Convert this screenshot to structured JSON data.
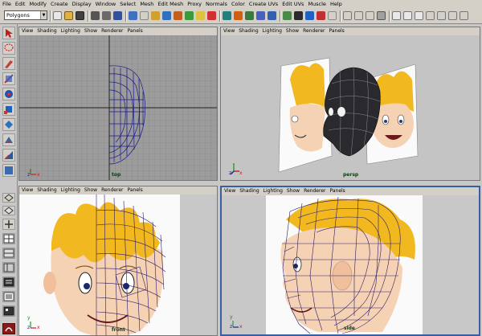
{
  "menubar": [
    "File",
    "Edit",
    "Modify",
    "Create",
    "Display",
    "Window",
    "Select",
    "Mesh",
    "Edit Mesh",
    "Proxy",
    "Normals",
    "Color",
    "Create UVs",
    "Edit UVs",
    "Muscle",
    "Help"
  ],
  "shelf": {
    "mode": "Polygons"
  },
  "viewport_menu": [
    "View",
    "Shading",
    "Lighting",
    "Show",
    "Renderer",
    "Panels"
  ],
  "viewports": {
    "top": {
      "camera": "top"
    },
    "persp": {
      "camera": "persp"
    },
    "front": {
      "camera": "front"
    },
    "side": {
      "camera": "side"
    }
  },
  "axes": {
    "x": "x",
    "y": "y",
    "z": "z"
  },
  "colors": {
    "grid_bg": "#9a9a9a",
    "grid_line": "#8a8a8a",
    "wire": "#1a1a8a",
    "active_border": "#3a5fa0",
    "hair": "#f2b820",
    "skin": "#f6d2b4"
  }
}
